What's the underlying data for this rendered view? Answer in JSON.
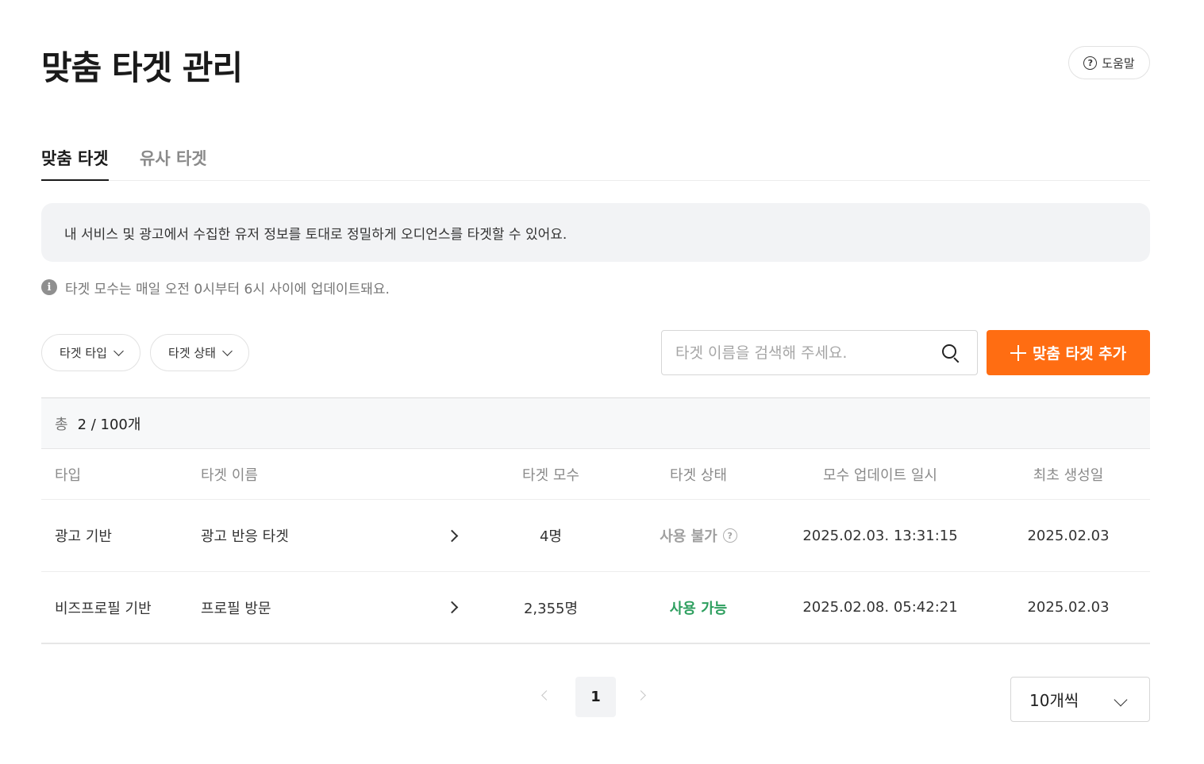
{
  "header": {
    "title": "맞춤 타겟 관리",
    "help_label": "도움말"
  },
  "tabs": [
    {
      "label": "맞춤 타겟",
      "active": true
    },
    {
      "label": "유사 타겟",
      "active": false
    }
  ],
  "banner": {
    "text": "내 서비스 및 광고에서 수집한 유저 정보를 토대로 정밀하게 오디언스를 타겟할 수 있어요."
  },
  "notice": {
    "icon": "info-icon",
    "text": "타겟 모수는 매일 오전 0시부터 6시 사이에 업데이트돼요."
  },
  "filters": {
    "type_label": "타겟 타입",
    "status_label": "타겟 상태"
  },
  "search": {
    "placeholder": "타겟 이름을 검색해 주세요.",
    "value": ""
  },
  "add_button": {
    "label": "맞춤 타겟 추가",
    "color": "#ff6d12"
  },
  "summary": {
    "label": "총",
    "count": "2 / 100개"
  },
  "table": {
    "columns": [
      "타입",
      "타겟 이름",
      "타겟 모수",
      "타겟 상태",
      "모수 업데이트 일시",
      "최초 생성일"
    ],
    "rows": [
      {
        "type": "광고 기반",
        "name": "광고 반응 타겟",
        "count": "4명",
        "status": "사용 불가",
        "status_color": "#a0a0a0",
        "updated": "2025.02.03. 13:31:15",
        "created": "2025.02.03"
      },
      {
        "type": "비즈프로필 기반",
        "name": "프로필 방문",
        "count": "2,355명",
        "status": "사용 가능",
        "status_color": "#2e9f5f",
        "updated": "2025.02.08. 05:42:21",
        "created": "2025.02.03"
      }
    ]
  },
  "pagination": {
    "current_page": "1",
    "page_size_label": "10개씩"
  }
}
